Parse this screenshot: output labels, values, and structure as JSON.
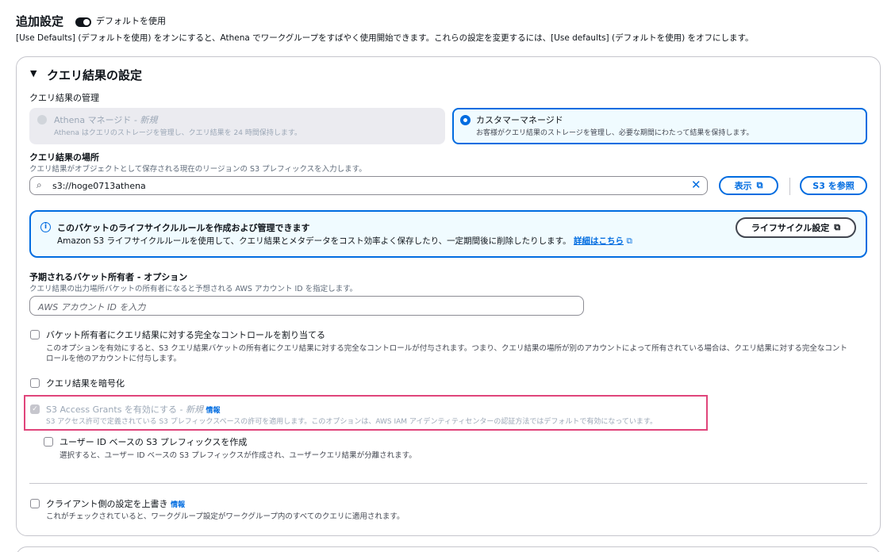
{
  "header": {
    "title": "追加設定",
    "toggle_label": "デフォルトを使用",
    "description": "[Use Defaults] (デフォルトを使用) をオンにすると、Athena でワークグループをすばやく使用開始できます。これらの設定を変更するには、[Use defaults] (デフォルトを使用) をオフにします。"
  },
  "section": {
    "title": "クエリ結果の設定",
    "management_label": "クエリ結果の管理",
    "athena_managed": {
      "title": "Athena マネージド",
      "badge": "- 新規",
      "description": "Athena はクエリのストレージを管理し、クエリ結果を 24 時間保持します。"
    },
    "customer_managed": {
      "title": "カスタマーマネージド",
      "description": "お客様がクエリ結果のストレージを管理し、必要な期間にわたって結果を保持します。"
    },
    "location": {
      "label": "クエリ結果の場所",
      "description": "クエリ結果がオブジェクトとして保存される現在のリージョンの S3 プレフィックスを入力します。",
      "value": "s3://hoge0713athena",
      "view_button": "表示",
      "browse_button": "S3 を参照"
    },
    "info": {
      "title": "このバケットのライフサイクルルールを作成および管理できます",
      "description": "Amazon S3 ライフサイクルルールを使用して、クエリ結果とメタデータをコスト効率よく保存したり、一定期間後に削除したりします。",
      "link": "詳細はこちら",
      "button": "ライフサイクル設定"
    },
    "owner": {
      "label": "予期されるバケット所有者 - オプション",
      "description": "クエリ結果の出力場所バケットの所有者になると予想される AWS アカウント ID を指定します。",
      "placeholder": "AWS アカウント ID を入力"
    },
    "full_control": {
      "label": "バケット所有者にクエリ結果に対する完全なコントロールを割り当てる",
      "description_line1": "このオプションを有効にすると、S3 クエリ結果バケットの所有者にクエリ結果に対する完全なコントロールが付与されます。つまり、クエリ結果の場所が別のアカウントによって所有されている場合は、クエリ結果に対する完全なコント",
      "description_line2": "ロールを他のアカウントに付与します。"
    },
    "encrypt": {
      "label": "クエリ結果を暗号化"
    },
    "access_grants": {
      "label": "S3 Access Grants を有効にする",
      "badge": "- 新規",
      "info": "情報",
      "description": "S3 アクセス許可で定義されている S3 プレフィックスペースの許可を適用します。このオプションは、AWS IAM アイデンティティセンターの認証方法ではデフォルトで有効になっています。"
    },
    "user_prefix": {
      "label": "ユーザー ID ベースの S3 プレフィックスを作成",
      "description": "選択すると、ユーザー ID ベースの S3 プレフィックスが作成され、ユーザークエリ結果が分離されます。"
    },
    "override": {
      "label": "クライアント側の設定を上書き",
      "info": "情報",
      "description": "これがチェックされていると、ワークグループ設定がワークグループ内のすべてのクエリに適用されます。"
    }
  },
  "colors": {
    "accent": "#006ce0",
    "highlight": "#e0457b",
    "info_bg": "#f0fbff"
  }
}
